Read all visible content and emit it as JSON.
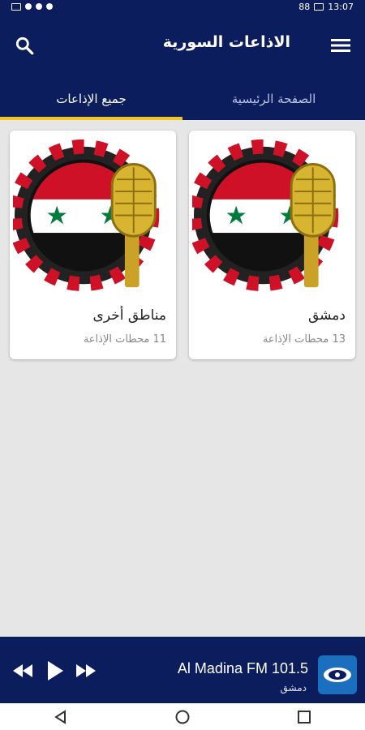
{
  "status_bar": {
    "battery": "88",
    "time": "13:07"
  },
  "app_bar": {
    "title": "الاذاعات السورية"
  },
  "tabs": [
    {
      "label": "الصفحة الرئيسية"
    },
    {
      "label": "جميع الإذاعات"
    }
  ],
  "cards": [
    {
      "title": "دمشق",
      "count_text": "13 محطات الإذاعة"
    },
    {
      "title": "مناطق أخرى",
      "count_text": "11 محطات الإذاعة"
    }
  ],
  "player": {
    "station": "Al Madina FM 101.5",
    "subtitle": "دمشق"
  },
  "colors": {
    "primary": "#0b1d5c",
    "accent": "#f3c623",
    "flag_red": "#ce1126",
    "flag_green": "#007a3d"
  },
  "icons": [
    "menu-icon",
    "search-icon",
    "rewind-icon",
    "play-icon",
    "fast-forward-icon",
    "back-icon",
    "home-icon",
    "recents-icon"
  ]
}
